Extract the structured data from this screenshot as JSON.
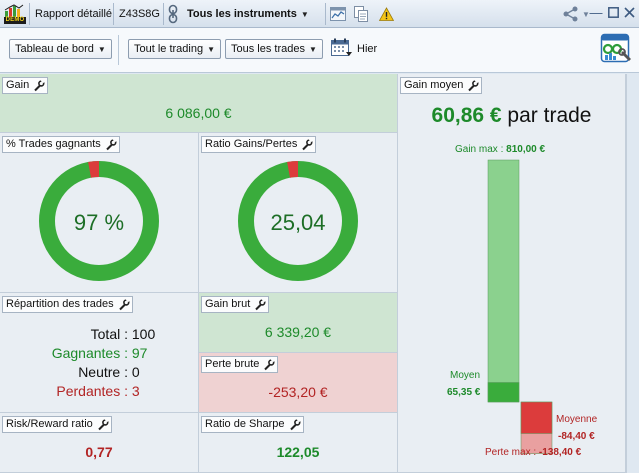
{
  "titlebar": {
    "demo_badge": "DEMO",
    "report_name": "Rapport détaillé",
    "account_id": "Z43S8G",
    "instrument_filter": "Tous les instruments"
  },
  "toolbar": {
    "dashboard_dropdown": "Tableau de bord",
    "trading_dropdown": "Tout le trading",
    "trades_dropdown": "Tous les trades",
    "period_label": "Hier"
  },
  "panels": {
    "gain": {
      "title": "Gain",
      "value": "6 086,00 €"
    },
    "win_pct": {
      "title": "% Trades gagnants",
      "value": "97 %",
      "ratio": 0.97
    },
    "ratio": {
      "title": "Ratio Gains/Pertes",
      "value": "25,04",
      "ratio": 0.97
    },
    "repartition": {
      "title": "Répartition des trades",
      "rows": [
        {
          "label": "Total :",
          "value": "100",
          "color": "#111111"
        },
        {
          "label": "Gagnantes :",
          "value": "97",
          "color": "#1d8a2a"
        },
        {
          "label": "Neutre :",
          "value": "0",
          "color": "#111111"
        },
        {
          "label": "Perdantes :",
          "value": "3",
          "color": "#b22424"
        }
      ]
    },
    "gross_gain": {
      "title": "Gain brut",
      "value": "6 339,20 €"
    },
    "gross_loss": {
      "title": "Perte brute",
      "value": "-253,20 €"
    },
    "risk_reward": {
      "title": "Risk/Reward ratio",
      "value": "0,77"
    },
    "sharpe": {
      "title": "Ratio de Sharpe",
      "value": "122,05"
    },
    "avg_gain": {
      "title": "Gain moyen",
      "amount": "60,86 €",
      "suffix": " par trade",
      "max_gain_label": "Gain max :",
      "max_gain_value": "810,00 €",
      "avg_label": "Moyen",
      "avg_value": "65,35 €",
      "avg_loss_label": "Moyenne",
      "avg_loss_value": "-84,40 €",
      "max_loss_label": "Perte max :",
      "max_loss_value": "-138,40 €"
    }
  },
  "chart_data": {
    "type": "bar",
    "categories": [
      "Gain max",
      "Moyen",
      "Perte max",
      "Moyenne"
    ],
    "values": [
      810.0,
      65.35,
      -138.4,
      -84.4
    ],
    "ylabel": ""
  },
  "colors": {
    "gain_green": "#3aac3c",
    "light_green": "#8bd18e",
    "loss_red": "#dc3c3c",
    "light_red": "#e9a0a0",
    "value_green": "#1d8a2a",
    "value_red": "#b22424"
  }
}
